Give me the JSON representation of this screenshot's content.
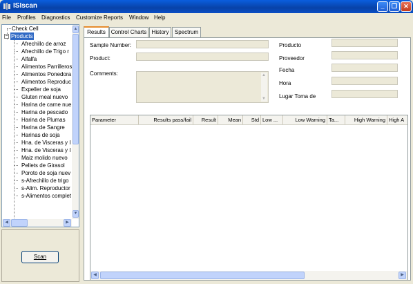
{
  "window": {
    "title": "ISIscan"
  },
  "menu": [
    "File",
    "Profiles",
    "Diagnostics",
    "Customize Reports",
    "Window",
    "Help"
  ],
  "tree": {
    "root_items": [
      {
        "label": "Check Cell"
      },
      {
        "label": "Products",
        "selected": true,
        "expander": "−"
      }
    ],
    "children": [
      "Afrechillo de arroz",
      "Afrechillo de Trigo r",
      "Alfalfa",
      "Alimentos Parrilleros",
      "Alimentos Ponedora",
      "Alimentos Reproduc",
      "Expeller de soja",
      "Gluten meal nuevo",
      "Harina de carne nue",
      "Harina de pescado",
      "Harina de Plumas",
      "Harina de Sangre",
      "Harinas de soja",
      "Hna. de Visceras y I",
      "Hna. de Visceras y I",
      "Maiz molido nuevo",
      "Pellets de Girasol",
      "Poroto de soja nuev",
      "s-Afrechillo de trigo",
      "s-Alim. Reproductor",
      "s-Alimentos complet"
    ]
  },
  "scan_button": "Scan",
  "tabs": [
    "Results",
    "Control Charts",
    "History",
    "Spectrum"
  ],
  "fields_left": [
    "Sample Number:",
    "Product:",
    "Comments:"
  ],
  "fields_right": [
    "Producto",
    "Proveedor",
    "Fecha",
    "Hora",
    "Lugar Toma de"
  ],
  "grid_columns": [
    "Parameter",
    "Results pass/fail",
    "Result",
    "Mean",
    "Std",
    "Low ...",
    "Low Warning",
    "Ta...",
    "High Warning",
    "High A"
  ],
  "icons": [
    "app-icon",
    "minimize-icon",
    "maximize-icon",
    "close-icon",
    "arrow-up-icon",
    "arrow-down-icon",
    "arrow-left-icon",
    "arrow-right-icon"
  ]
}
